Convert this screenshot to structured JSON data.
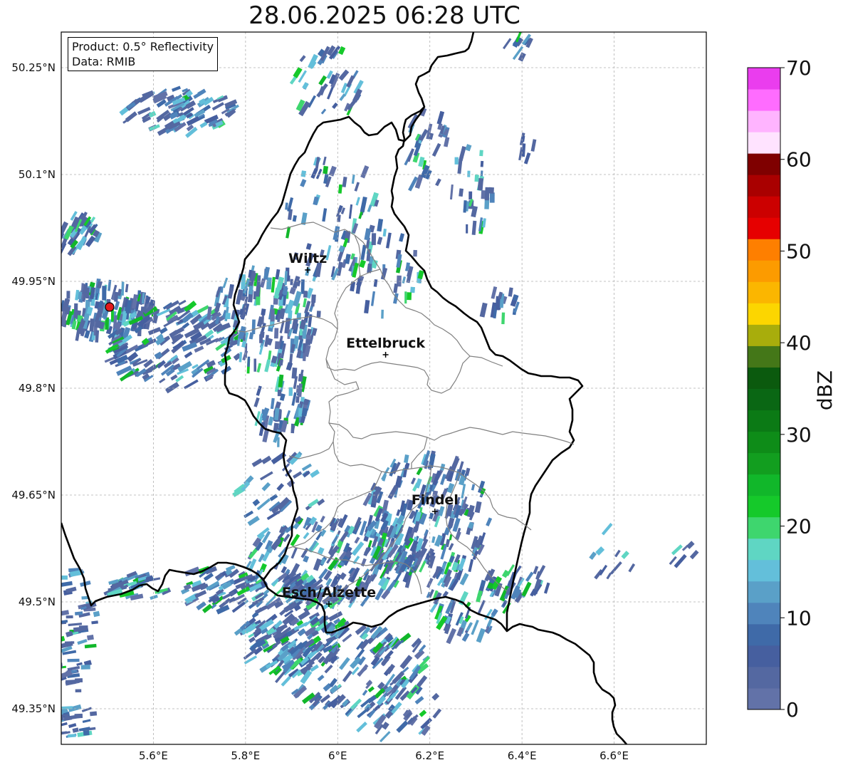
{
  "title": "28.06.2025 06:28 UTC",
  "info": {
    "product": "Product: 0.5° Reflectivity",
    "data": "Data: RMIB"
  },
  "x_ticks": [
    "5.6°E",
    "5.8°E",
    "6°E",
    "6.2°E",
    "6.4°E",
    "6.6°E"
  ],
  "y_ticks": [
    "50.25°N",
    "50.1°N",
    "49.95°N",
    "49.8°N",
    "49.65°N",
    "49.5°N",
    "49.35°N"
  ],
  "cities": [
    {
      "name": "Wiltz",
      "lon": 5.935,
      "lat": 49.966
    },
    {
      "name": "Ettelbruck",
      "lon": 6.104,
      "lat": 49.847
    },
    {
      "name": "Findel",
      "lon": 6.211,
      "lat": 49.627
    },
    {
      "name": "Esch/Alzette",
      "lon": 5.981,
      "lat": 49.497
    }
  ],
  "radar_site": {
    "lon": 5.505,
    "lat": 49.914,
    "color": "#e31a1c"
  },
  "map_extent": {
    "lon": [
      5.4,
      6.8
    ],
    "lat": [
      49.3,
      50.3
    ]
  },
  "colorbar": {
    "label": "dBZ",
    "ticks": [
      "0",
      "10",
      "20",
      "30",
      "40",
      "50",
      "60",
      "70"
    ],
    "min": 0,
    "max": 70,
    "step": 2.5,
    "colors": [
      "#6272a8",
      "#5468a1",
      "#465f9f",
      "#3f6aa8",
      "#4f84bb",
      "#5aa0c8",
      "#63bfda",
      "#5fd6c3",
      "#3ed66e",
      "#15c92a",
      "#11b72a",
      "#129e1f",
      "#0e8c18",
      "#0b7a15",
      "#0a6714",
      "#0b5a0e",
      "#447718",
      "#a8ad0c",
      "#fcd600",
      "#fbb600",
      "#fc9b00",
      "#fe7f00",
      "#e60000",
      "#cc0000",
      "#a90000",
      "#7f0000",
      "#ffe3ff",
      "#ffb4ff",
      "#ff6cff",
      "#ea3dee"
    ]
  }
}
